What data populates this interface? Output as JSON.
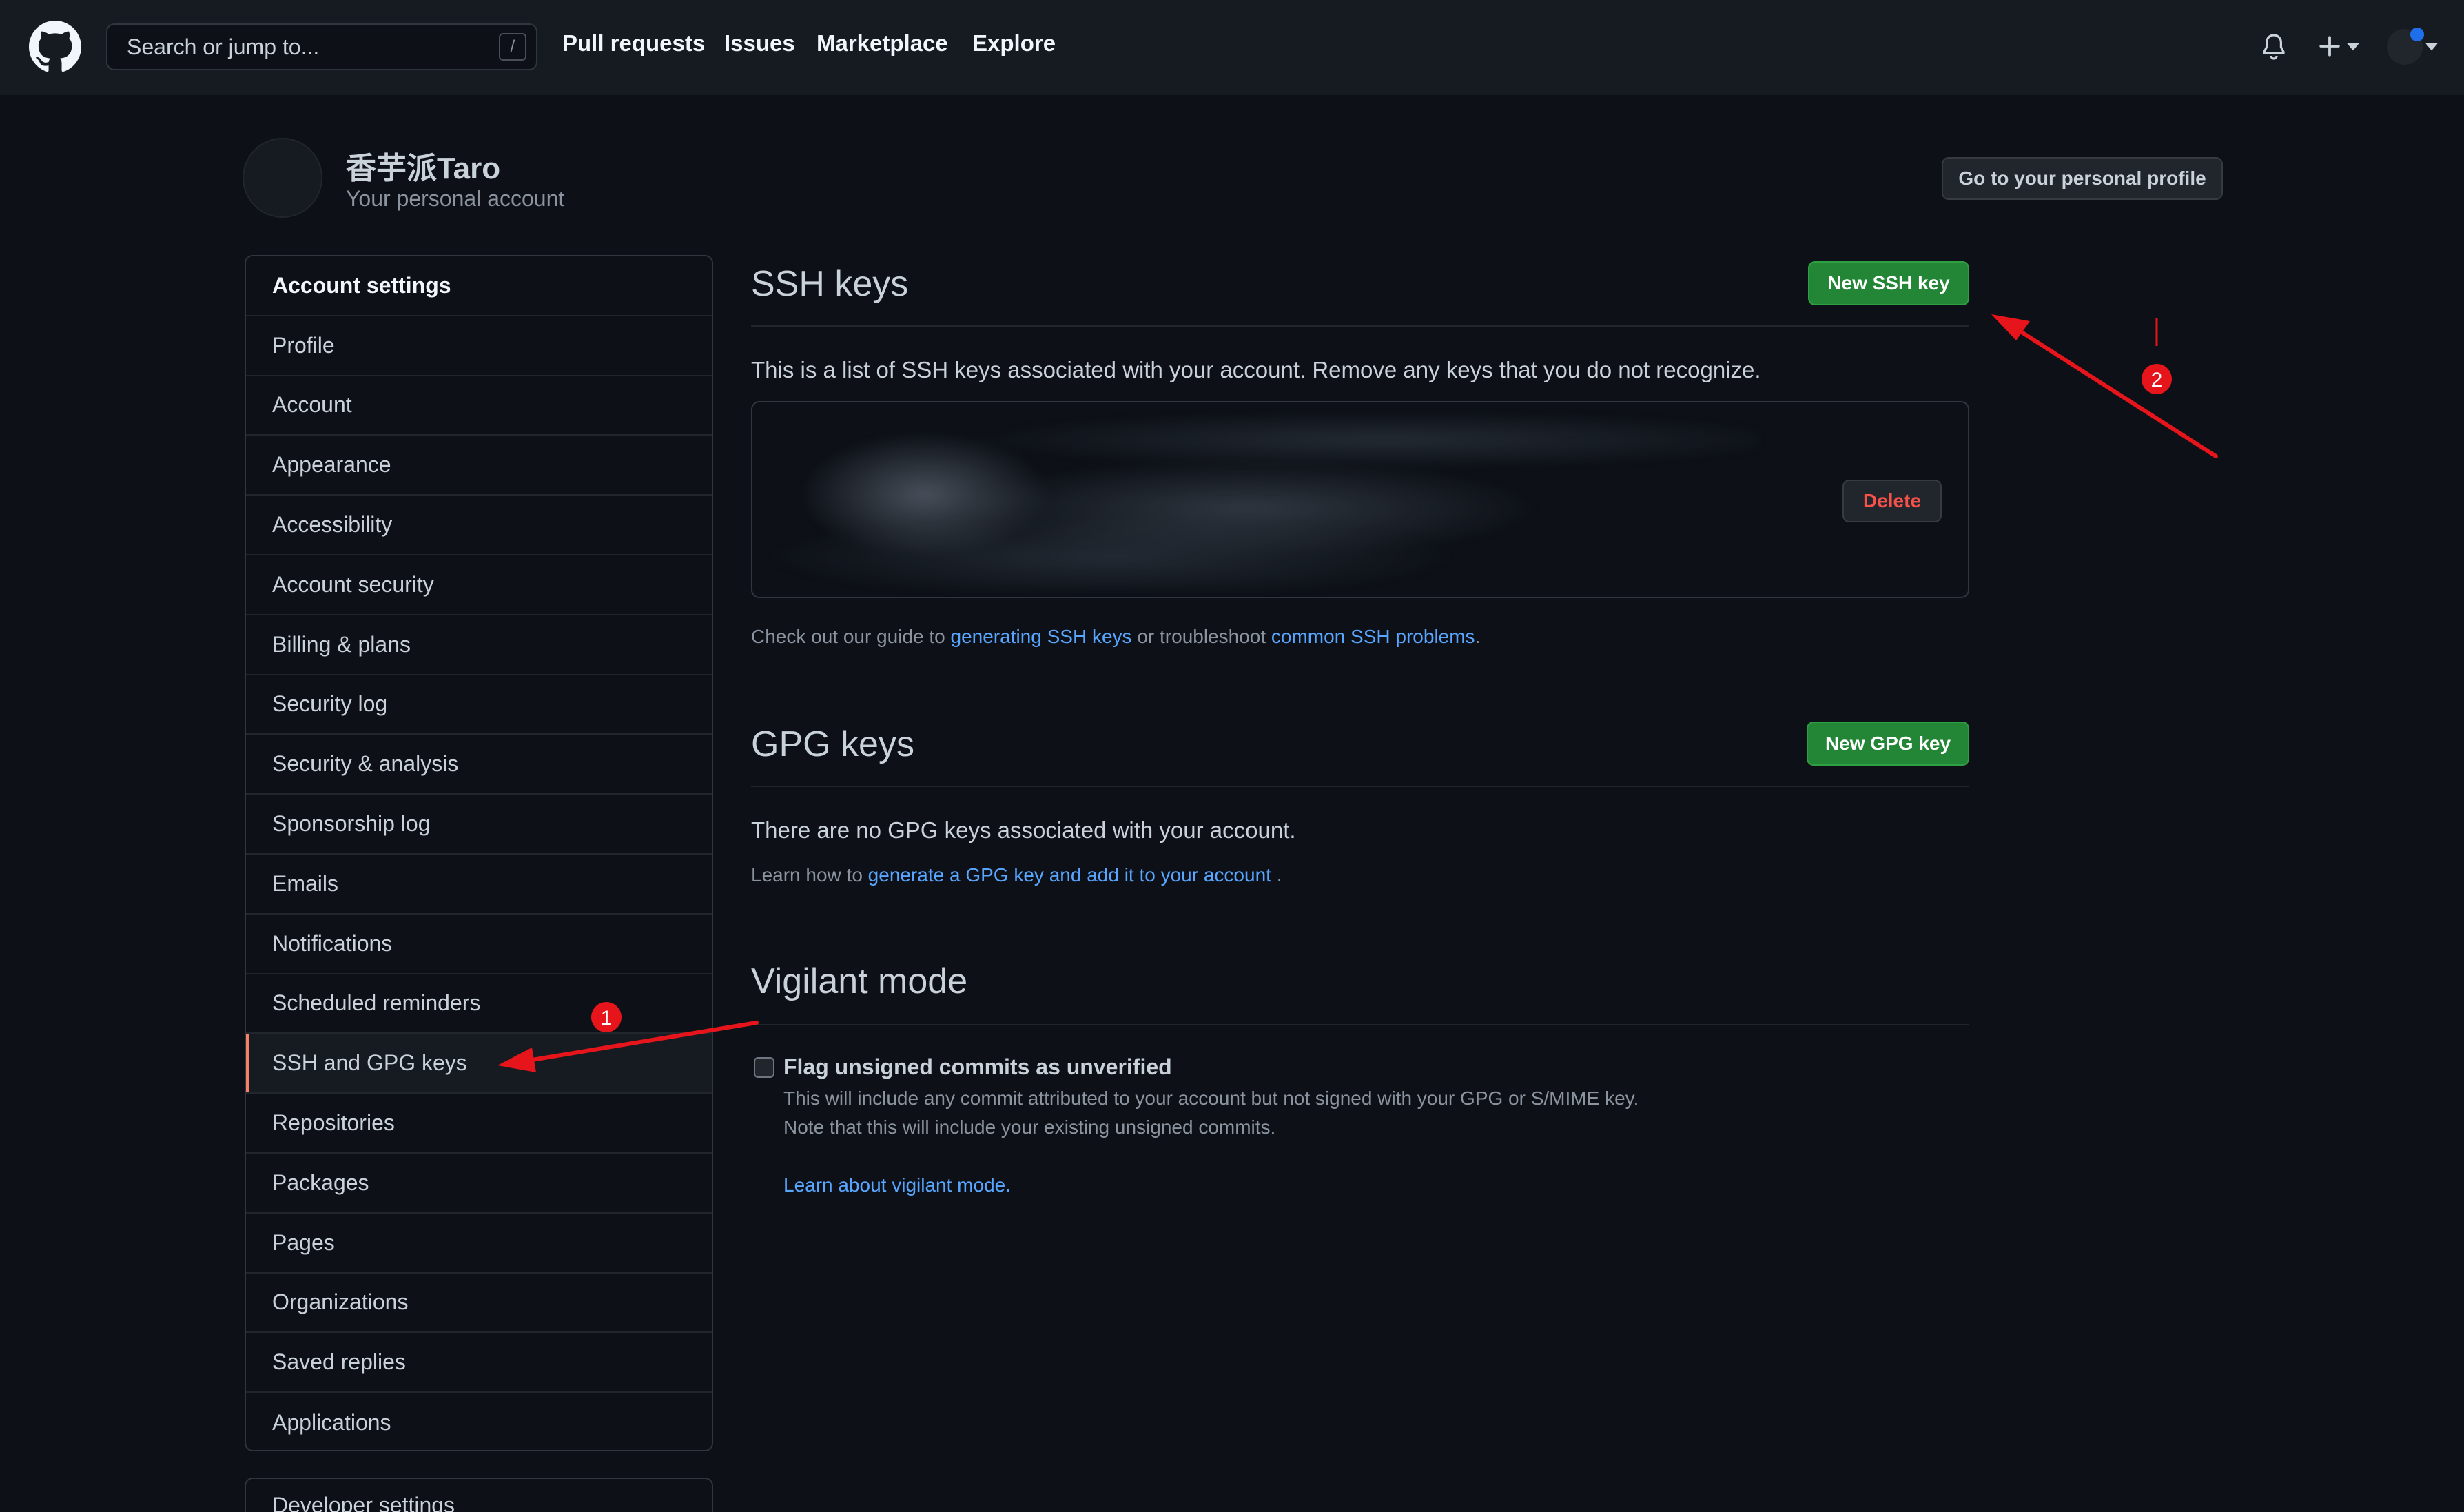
{
  "header": {
    "search_placeholder": "Search or jump to...",
    "search_shortcut": "/",
    "nav": [
      "Pull requests",
      "Issues",
      "Marketplace",
      "Explore"
    ],
    "icons": [
      "github-logo",
      "bell-icon",
      "plus-icon",
      "avatar"
    ]
  },
  "profile": {
    "name": "香芋派Taro",
    "subtitle": "Your personal account",
    "go_profile": "Go to your personal profile"
  },
  "sidebar": {
    "heading": "Account settings",
    "items": [
      "Profile",
      "Account",
      "Appearance",
      "Accessibility",
      "Account security",
      "Billing & plans",
      "Security log",
      "Security & analysis",
      "Sponsorship log",
      "Emails",
      "Notifications",
      "Scheduled reminders",
      "SSH and GPG keys",
      "Repositories",
      "Packages",
      "Pages",
      "Organizations",
      "Saved replies",
      "Applications"
    ],
    "active": "SSH and GPG keys",
    "developer": "Developer settings"
  },
  "ssh": {
    "title": "SSH keys",
    "new_btn": "New SSH key",
    "desc": "This is a list of SSH keys associated with your account. Remove any keys that you do not recognize.",
    "delete": "Delete",
    "guide_pre": "Check out our guide to ",
    "guide_link1": "generating SSH keys",
    "guide_mid": " or troubleshoot ",
    "guide_link2": "common SSH problems",
    "guide_end": "."
  },
  "gpg": {
    "title": "GPG keys",
    "new_btn": "New GPG key",
    "empty": "There are no GPG keys associated with your account.",
    "learn_pre": "Learn how to ",
    "learn_link": "generate a GPG key and add it to your account",
    "learn_end": " ."
  },
  "vigilant": {
    "title": "Vigilant mode",
    "checkbox_label": "Flag unsigned commits as unverified",
    "note1": "This will include any commit attributed to your account but not signed with your GPG or S/MIME key.",
    "note2": "Note that this will include your existing unsigned commits.",
    "learn": "Learn about vigilant mode."
  },
  "annotations": {
    "marker1": "1",
    "marker2": "2",
    "color": "#e5151b"
  },
  "colors": {
    "bg": "#0d1117",
    "header": "#161b22",
    "accent_green": "#238636",
    "link": "#58a6ff",
    "active_bar": "#f78166"
  }
}
